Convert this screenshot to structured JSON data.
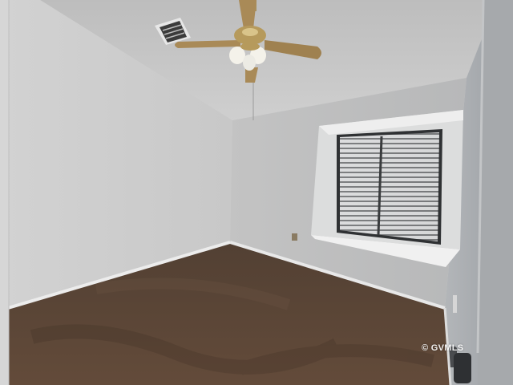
{
  "photo": {
    "subject": "empty-bedroom",
    "watermark": "© GVMLS"
  },
  "colors": {
    "ceiling": "#c6c6c6",
    "left_wall": "#cdcdcd",
    "back_wall": "#bdbdbd",
    "right_wall": "#aeb1b4",
    "carpet": "#5b4535",
    "baseboard": "#e9e9e9",
    "fan_brass": "#b69a5c",
    "fan_blade": "#a98a57",
    "window_trim": "#e3e4e4",
    "blinds": "#d9dadb"
  }
}
